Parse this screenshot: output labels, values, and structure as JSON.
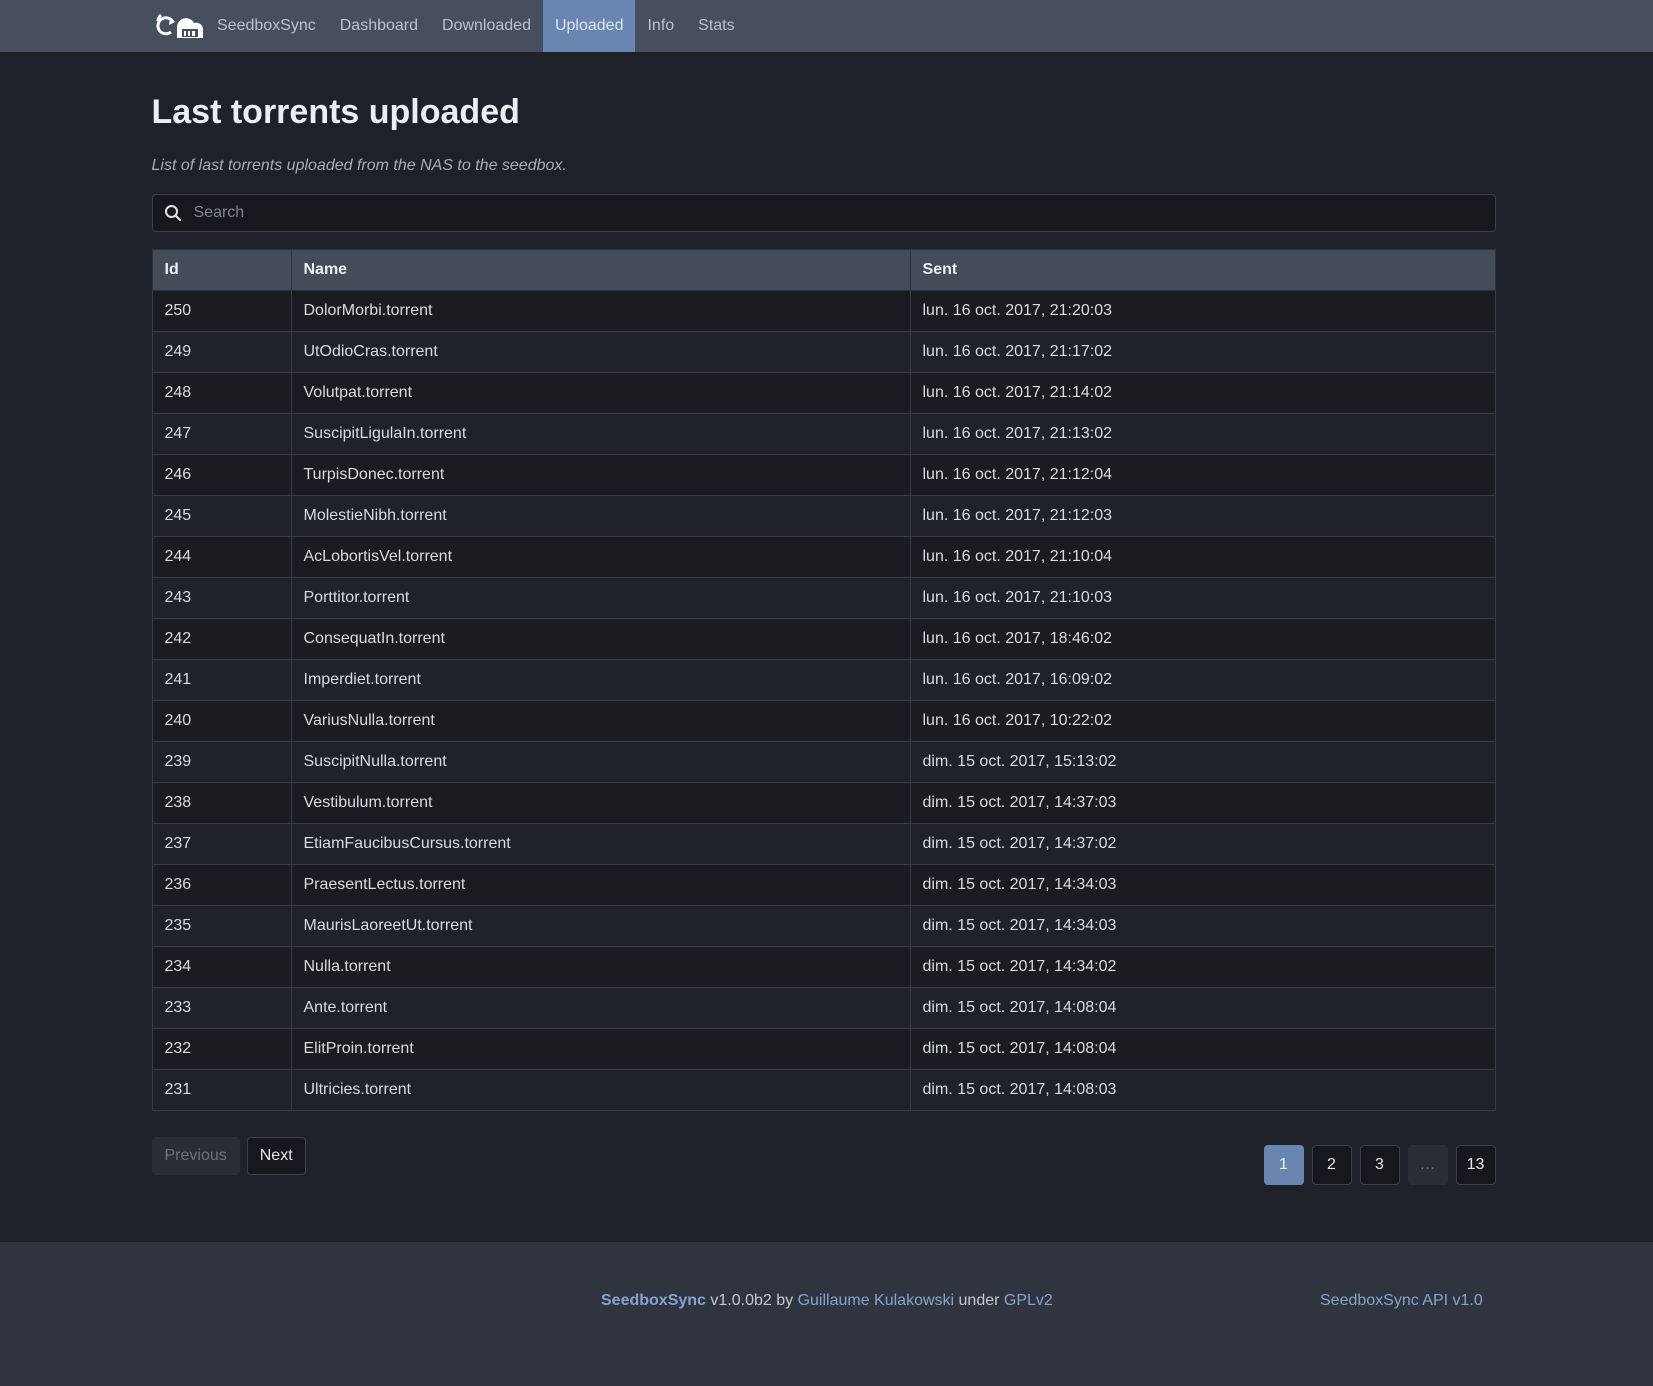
{
  "nav": {
    "brand": "SeedboxSync",
    "items": [
      {
        "label": "Dashboard"
      },
      {
        "label": "Downloaded"
      },
      {
        "label": "Uploaded",
        "active": true
      },
      {
        "label": "Info"
      },
      {
        "label": "Stats"
      }
    ]
  },
  "page": {
    "title": "Last torrents uploaded",
    "subtitle": "List of last torrents uploaded from the NAS to the seedbox."
  },
  "search": {
    "placeholder": "Search"
  },
  "table": {
    "headers": {
      "id": "Id",
      "name": "Name",
      "sent": "Sent"
    },
    "rows": [
      {
        "id": "250",
        "name": "DolorMorbi.torrent",
        "sent": "lun. 16 oct. 2017, 21:20:03"
      },
      {
        "id": "249",
        "name": "UtOdioCras.torrent",
        "sent": "lun. 16 oct. 2017, 21:17:02"
      },
      {
        "id": "248",
        "name": "Volutpat.torrent",
        "sent": "lun. 16 oct. 2017, 21:14:02"
      },
      {
        "id": "247",
        "name": "SuscipitLigulaIn.torrent",
        "sent": "lun. 16 oct. 2017, 21:13:02"
      },
      {
        "id": "246",
        "name": "TurpisDonec.torrent",
        "sent": "lun. 16 oct. 2017, 21:12:04"
      },
      {
        "id": "245",
        "name": "MolestieNibh.torrent",
        "sent": "lun. 16 oct. 2017, 21:12:03"
      },
      {
        "id": "244",
        "name": "AcLobortisVel.torrent",
        "sent": "lun. 16 oct. 2017, 21:10:04"
      },
      {
        "id": "243",
        "name": "Porttitor.torrent",
        "sent": "lun. 16 oct. 2017, 21:10:03"
      },
      {
        "id": "242",
        "name": "ConsequatIn.torrent",
        "sent": "lun. 16 oct. 2017, 18:46:02"
      },
      {
        "id": "241",
        "name": "Imperdiet.torrent",
        "sent": "lun. 16 oct. 2017, 16:09:02"
      },
      {
        "id": "240",
        "name": "VariusNulla.torrent",
        "sent": "lun. 16 oct. 2017, 10:22:02"
      },
      {
        "id": "239",
        "name": "SuscipitNulla.torrent",
        "sent": "dim. 15 oct. 2017, 15:13:02"
      },
      {
        "id": "238",
        "name": "Vestibulum.torrent",
        "sent": "dim. 15 oct. 2017, 14:37:03"
      },
      {
        "id": "237",
        "name": "EtiamFaucibusCursus.torrent",
        "sent": "dim. 15 oct. 2017, 14:37:02"
      },
      {
        "id": "236",
        "name": "PraesentLectus.torrent",
        "sent": "dim. 15 oct. 2017, 14:34:03"
      },
      {
        "id": "235",
        "name": "MaurisLaoreetUt.torrent",
        "sent": "dim. 15 oct. 2017, 14:34:03"
      },
      {
        "id": "234",
        "name": "Nulla.torrent",
        "sent": "dim. 15 oct. 2017, 14:34:02"
      },
      {
        "id": "233",
        "name": "Ante.torrent",
        "sent": "dim. 15 oct. 2017, 14:08:04"
      },
      {
        "id": "232",
        "name": "ElitProin.torrent",
        "sent": "dim. 15 oct. 2017, 14:08:04"
      },
      {
        "id": "231",
        "name": "Ultricies.torrent",
        "sent": "dim. 15 oct. 2017, 14:08:03"
      }
    ]
  },
  "pager": {
    "previous": "Previous",
    "next": "Next",
    "pages": [
      {
        "label": "1",
        "active": true
      },
      {
        "label": "2"
      },
      {
        "label": "3"
      },
      {
        "label": "…",
        "ellipsis": true
      },
      {
        "label": "13"
      }
    ]
  },
  "footer": {
    "app": "SeedboxSync",
    "version": " v1.0.0b2 by ",
    "author": "Guillaume Kulakowski",
    "under": " under ",
    "license": "GPLv2",
    "api": "SeedboxSync API v1.0"
  },
  "colors": {
    "accent": "#6886b0",
    "navbar": "#474f5e",
    "background": "#1e2129",
    "footer": "#30343f"
  },
  "icons": {
    "brand": "cloud-sync-icon",
    "search": "search-icon"
  }
}
